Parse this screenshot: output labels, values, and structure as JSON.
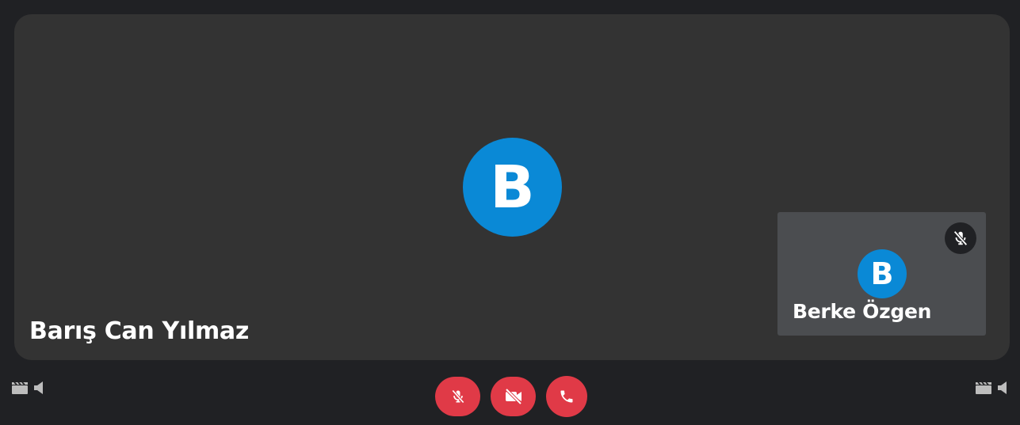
{
  "main": {
    "avatar_initial": "B",
    "participant_name": "Barış Can Yılmaz",
    "avatar_color": "#0a89d6",
    "background_color": "#333333"
  },
  "pip": {
    "avatar_initial": "B",
    "participant_name": "Berke Özgen",
    "muted": true,
    "mute_icon": "mic-off-icon"
  },
  "controls": {
    "left": [
      {
        "icon": "clapperboard-icon"
      },
      {
        "icon": "speaker-icon"
      }
    ],
    "right": [
      {
        "icon": "clapperboard-icon"
      },
      {
        "icon": "speaker-icon"
      }
    ],
    "call": [
      {
        "icon": "mic-off-icon",
        "action": "toggle-microphone"
      },
      {
        "icon": "video-off-icon",
        "action": "toggle-camera"
      },
      {
        "icon": "phone-icon",
        "action": "end-call"
      }
    ],
    "button_color": "#e03a47"
  },
  "theme": {
    "page_background": "#202124",
    "pip_background": "#4b4d50"
  }
}
